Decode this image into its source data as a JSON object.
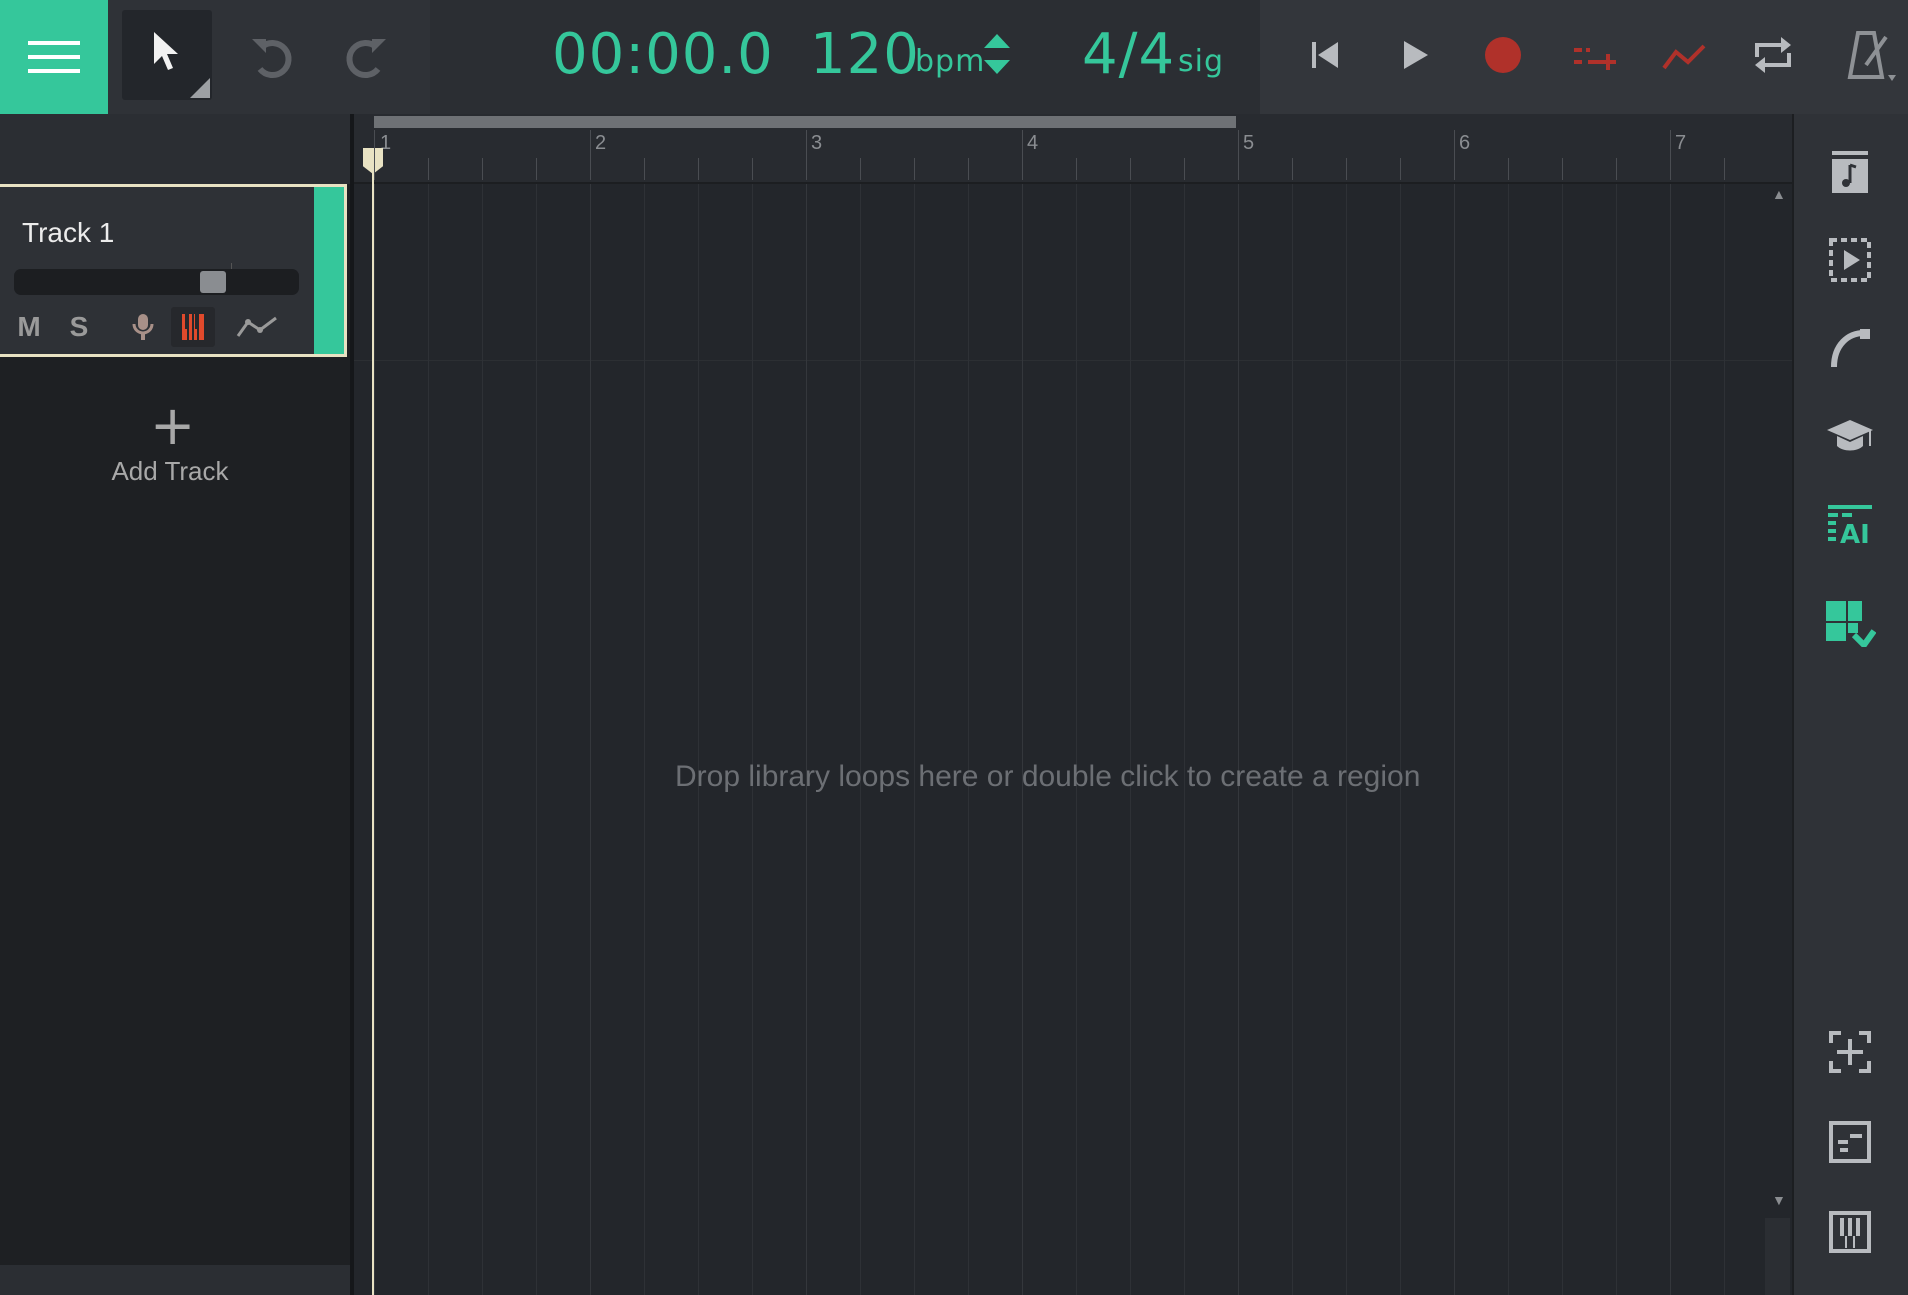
{
  "toolbar": {
    "menu_icon": "hamburger-menu-icon",
    "pointer_icon": "pointer-cursor-icon",
    "undo_icon": "undo-icon",
    "redo_icon": "redo-icon",
    "time": "00:00.0",
    "bpm_value": "120",
    "bpm_unit": "bpm",
    "sig_value": "4/4",
    "sig_unit": "sig",
    "accent_color": "#35c79b",
    "record_color": "#b0312a"
  },
  "transport": {
    "items": [
      "skip-to-start-icon",
      "play-icon",
      "record-icon",
      "count-in-icon",
      "automation-icon",
      "loop-icon",
      "metronome-icon"
    ]
  },
  "track": {
    "name": "Track 1",
    "mute_label": "M",
    "solo_label": "S",
    "volume_level": 0.72,
    "color": "#35c79b"
  },
  "add_track": {
    "plus": "+",
    "label": "Add Track"
  },
  "ruler": {
    "bars": [
      "1",
      "2",
      "3",
      "4",
      "5",
      "6",
      "7"
    ]
  },
  "timeline": {
    "drop_hint": "Drop library loops here or double click to create a region"
  },
  "sidebar": {
    "top_items": [
      "sound-library-icon",
      "video-icon",
      "fx-icon",
      "learn-icon",
      "ai-icon",
      "plugins-icon"
    ],
    "bottom_items": [
      "snap-icon",
      "editor-icon",
      "keyboard-icon"
    ]
  }
}
